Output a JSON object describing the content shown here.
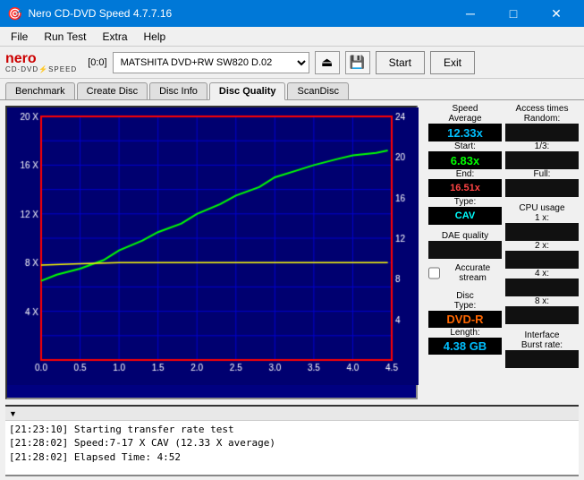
{
  "titleBar": {
    "title": "Nero CD-DVD Speed 4.7.7.16",
    "icon": "●",
    "controls": [
      "─",
      "□",
      "✕"
    ]
  },
  "menuBar": {
    "items": [
      "File",
      "Run Test",
      "Extra",
      "Help"
    ]
  },
  "toolbar": {
    "driveLabel": "[0:0]",
    "driveValue": "MATSHITA DVD+RW SW820 D.02",
    "startLabel": "Start",
    "exitLabel": "Exit"
  },
  "tabs": [
    {
      "label": "Benchmark",
      "active": false
    },
    {
      "label": "Create Disc",
      "active": false
    },
    {
      "label": "Disc Info",
      "active": false
    },
    {
      "label": "Disc Quality",
      "active": true
    },
    {
      "label": "ScanDisc",
      "active": false
    }
  ],
  "stats": {
    "speed": {
      "label": "Speed",
      "average": {
        "label": "Average",
        "value": "12.33x"
      },
      "start": {
        "label": "Start:",
        "value": "6.83x"
      },
      "end": {
        "label": "End:",
        "value": "16.51x"
      },
      "type": {
        "label": "Type:",
        "value": "CAV"
      }
    },
    "accessTimes": {
      "label": "Access times",
      "random": {
        "label": "Random:",
        "value": ""
      },
      "oneThird": {
        "label": "1/3:",
        "value": ""
      },
      "full": {
        "label": "Full:",
        "value": ""
      }
    },
    "daeQuality": {
      "label": "DAE quality",
      "value": ""
    },
    "accurateStream": {
      "label": "Accurate stream",
      "checked": false
    },
    "cpuUsage": {
      "label": "CPU usage",
      "1x": {
        "label": "1 x:",
        "value": ""
      },
      "2x": {
        "label": "2 x:",
        "value": ""
      },
      "4x": {
        "label": "4 x:",
        "value": ""
      },
      "8x": {
        "label": "8 x:",
        "value": ""
      }
    },
    "disc": {
      "label": "Disc",
      "typeLabel": "Type:",
      "typeValue": "DVD-R",
      "lengthLabel": "Length:",
      "lengthValue": "4.38 GB"
    },
    "interface": {
      "label": "Interface",
      "burstRate": {
        "label": "Burst rate:",
        "value": ""
      }
    }
  },
  "chart": {
    "xAxis": {
      "min": 0.0,
      "max": 4.5,
      "labels": [
        "0.0",
        "0.5",
        "1.0",
        "1.5",
        "2.0",
        "2.5",
        "3.0",
        "3.5",
        "4.0",
        "4.5"
      ]
    },
    "yAxisLeft": {
      "min": 0,
      "max": 20,
      "labels": [
        "20 X",
        "16 X",
        "12 X",
        "8 X",
        "4 X"
      ]
    },
    "yAxisRight": {
      "min": 0,
      "max": 24,
      "labels": [
        "24",
        "20",
        "16",
        "12",
        "8",
        "4"
      ]
    }
  },
  "log": {
    "entries": [
      "[21:23:10]  Starting transfer rate test",
      "[21:28:02]  Speed:7-17 X CAV (12.33 X average)",
      "[21:28:02]  Elapsed Time: 4:52"
    ]
  }
}
